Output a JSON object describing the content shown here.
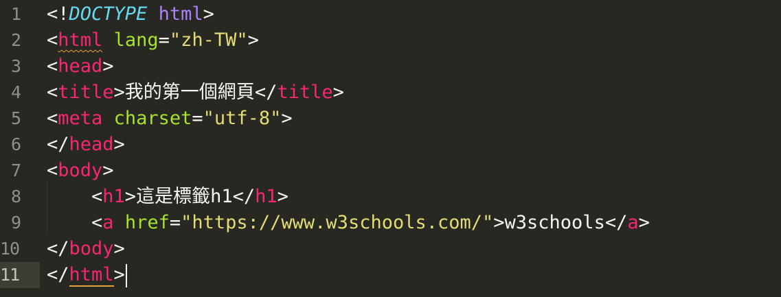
{
  "editor": {
    "active_line": 11,
    "colors": {
      "background": "#272822",
      "tag": "#f92672",
      "attribute": "#a6e22e",
      "string": "#e6db74",
      "doctype": "#66d9ef",
      "keyword": "#ae81ff",
      "gutter_text": "#90908a"
    },
    "lines": [
      {
        "num": "1",
        "tokens": [
          [
            "punc",
            "<!"
          ],
          [
            "doctype",
            "DOCTYPE"
          ],
          [
            "punc",
            " "
          ],
          [
            "doctype-kw",
            "html"
          ],
          [
            "punc",
            ">"
          ]
        ]
      },
      {
        "num": "2",
        "tokens": [
          [
            "punc",
            "<"
          ],
          [
            "tag-sq",
            "html"
          ],
          [
            "punc",
            " "
          ],
          [
            "attr",
            "lang"
          ],
          [
            "punc",
            "="
          ],
          [
            "str",
            "\"zh-TW\""
          ],
          [
            "punc",
            ">"
          ]
        ]
      },
      {
        "num": "3",
        "tokens": [
          [
            "punc",
            "<"
          ],
          [
            "tag",
            "head"
          ],
          [
            "punc",
            ">"
          ]
        ]
      },
      {
        "num": "4",
        "tokens": [
          [
            "punc",
            "<"
          ],
          [
            "tag",
            "title"
          ],
          [
            "punc",
            ">"
          ],
          [
            "text",
            "我的第一個網頁"
          ],
          [
            "punc",
            "</"
          ],
          [
            "tag",
            "title"
          ],
          [
            "punc",
            ">"
          ]
        ]
      },
      {
        "num": "5",
        "tokens": [
          [
            "punc",
            "<"
          ],
          [
            "tag",
            "meta"
          ],
          [
            "punc",
            " "
          ],
          [
            "attr",
            "charset"
          ],
          [
            "punc",
            "="
          ],
          [
            "str",
            "\"utf-8\""
          ],
          [
            "punc",
            ">"
          ]
        ]
      },
      {
        "num": "6",
        "tokens": [
          [
            "punc",
            "</"
          ],
          [
            "tag",
            "head"
          ],
          [
            "punc",
            ">"
          ]
        ]
      },
      {
        "num": "7",
        "tokens": [
          [
            "punc",
            "<"
          ],
          [
            "tag",
            "body"
          ],
          [
            "punc",
            ">"
          ]
        ]
      },
      {
        "num": "8",
        "tokens": [
          [
            "punc",
            "    <"
          ],
          [
            "tag",
            "h1"
          ],
          [
            "punc",
            ">"
          ],
          [
            "text",
            "這是標籤"
          ],
          [
            "punc",
            "h1</"
          ],
          [
            "tag",
            "h1"
          ],
          [
            "punc",
            ">"
          ]
        ]
      },
      {
        "num": "9",
        "tokens": [
          [
            "punc",
            "    <"
          ],
          [
            "tag",
            "a"
          ],
          [
            "punc",
            " "
          ],
          [
            "attr",
            "href"
          ],
          [
            "punc",
            "="
          ],
          [
            "str",
            "\"https://www.w3schools.com/\""
          ],
          [
            "punc",
            ">w3schools</"
          ],
          [
            "tag",
            "a"
          ],
          [
            "punc",
            ">"
          ]
        ]
      },
      {
        "num": "10",
        "tokens": [
          [
            "punc",
            "</"
          ],
          [
            "tag",
            "body"
          ],
          [
            "punc",
            ">"
          ]
        ]
      },
      {
        "num": "11",
        "tokens": [
          [
            "punc",
            "</"
          ],
          [
            "tag-br",
            "html"
          ],
          [
            "punc",
            ">"
          ],
          [
            "cursor",
            ""
          ]
        ]
      }
    ]
  }
}
